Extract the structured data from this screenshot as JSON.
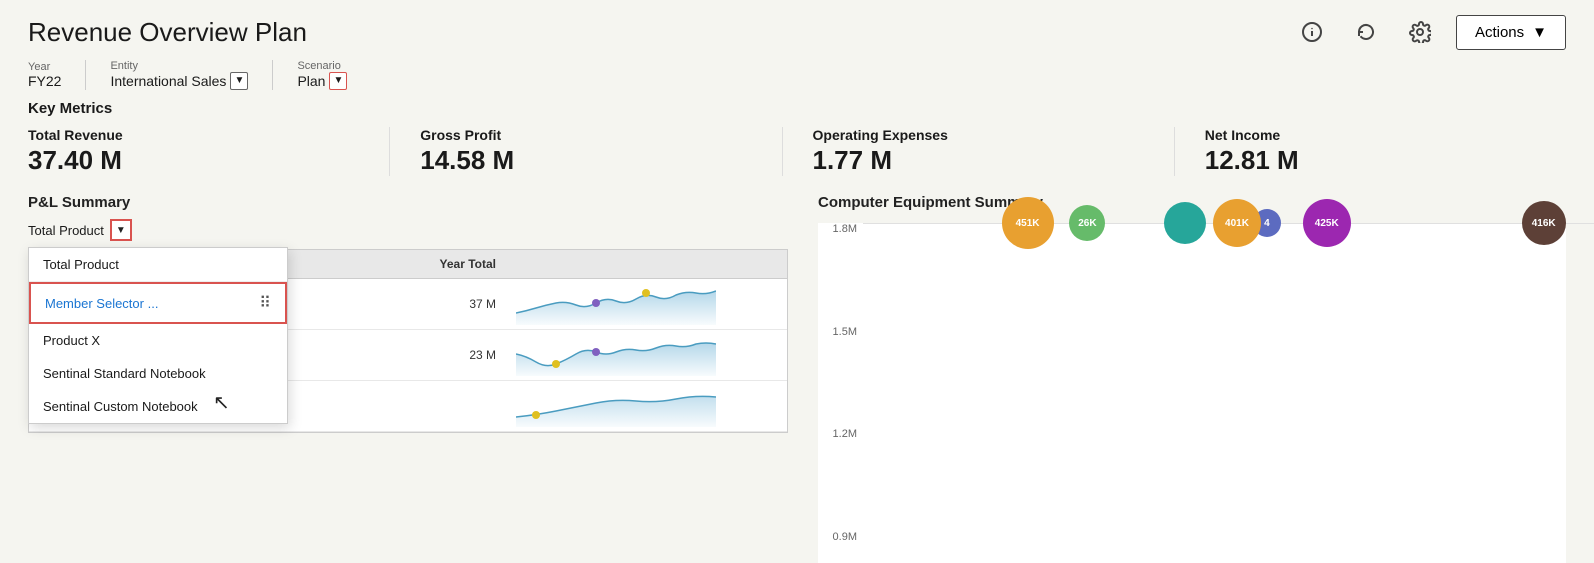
{
  "header": {
    "title": "Revenue Overview Plan",
    "actions_label": "Actions"
  },
  "filters": {
    "year_label": "Year",
    "year_value": "FY22",
    "entity_label": "Entity",
    "entity_value": "International Sales",
    "scenario_label": "Scenario",
    "scenario_value": "Plan"
  },
  "key_metrics": {
    "section_label": "Key Metrics",
    "total_revenue_label": "Total Revenue",
    "total_revenue_value": "37.40 M",
    "gross_profit_label": "Gross Profit",
    "gross_profit_value": "14.58 M",
    "operating_expenses_label": "Operating Expenses",
    "operating_expenses_value": "1.77 M",
    "net_income_label": "Net Income",
    "net_income_value": "12.81 M"
  },
  "pl_summary": {
    "title": "P&L Summary",
    "selector_label": "Total Product",
    "dropdown_items": [
      {
        "label": "Total Product",
        "type": "normal"
      },
      {
        "label": "Member Selector ...",
        "type": "highlighted"
      },
      {
        "label": "Product X",
        "type": "normal"
      },
      {
        "label": "Sentinal Standard Notebook",
        "type": "normal"
      },
      {
        "label": "Sentinal Custom Notebook",
        "type": "normal"
      }
    ],
    "table_headers": [
      "",
      "Year Total",
      ""
    ],
    "table_rows": [
      {
        "label": "",
        "year_total": "37 M"
      },
      {
        "label": "",
        "year_total": "23 M"
      }
    ]
  },
  "computer_equipment": {
    "title": "Computer Equipment Summary",
    "y_labels": [
      "1.8M",
      "1.5M",
      "1.2M",
      "0.9M"
    ],
    "bubbles": [
      {
        "label": "451K",
        "x": 22,
        "y": 20,
        "size": 52,
        "color": "#e8a030"
      },
      {
        "label": "26 K",
        "x": 28,
        "y": 22,
        "size": 38,
        "color": "#66bb6a"
      },
      {
        "label": "4",
        "x": 55,
        "y": 20,
        "size": 30,
        "color": "#5c6bc0"
      },
      {
        "label": "425K",
        "x": 61,
        "y": 20,
        "size": 46,
        "color": "#9c27b0"
      },
      {
        "label": "416 K",
        "x": 92,
        "y": 20,
        "size": 44,
        "color": "#5d4037"
      },
      {
        "label": "",
        "x": 42,
        "y": 50,
        "size": 42,
        "color": "#26a69a"
      },
      {
        "label": "401K",
        "x": 48,
        "y": 72,
        "size": 46,
        "color": "#e8a030"
      }
    ]
  }
}
